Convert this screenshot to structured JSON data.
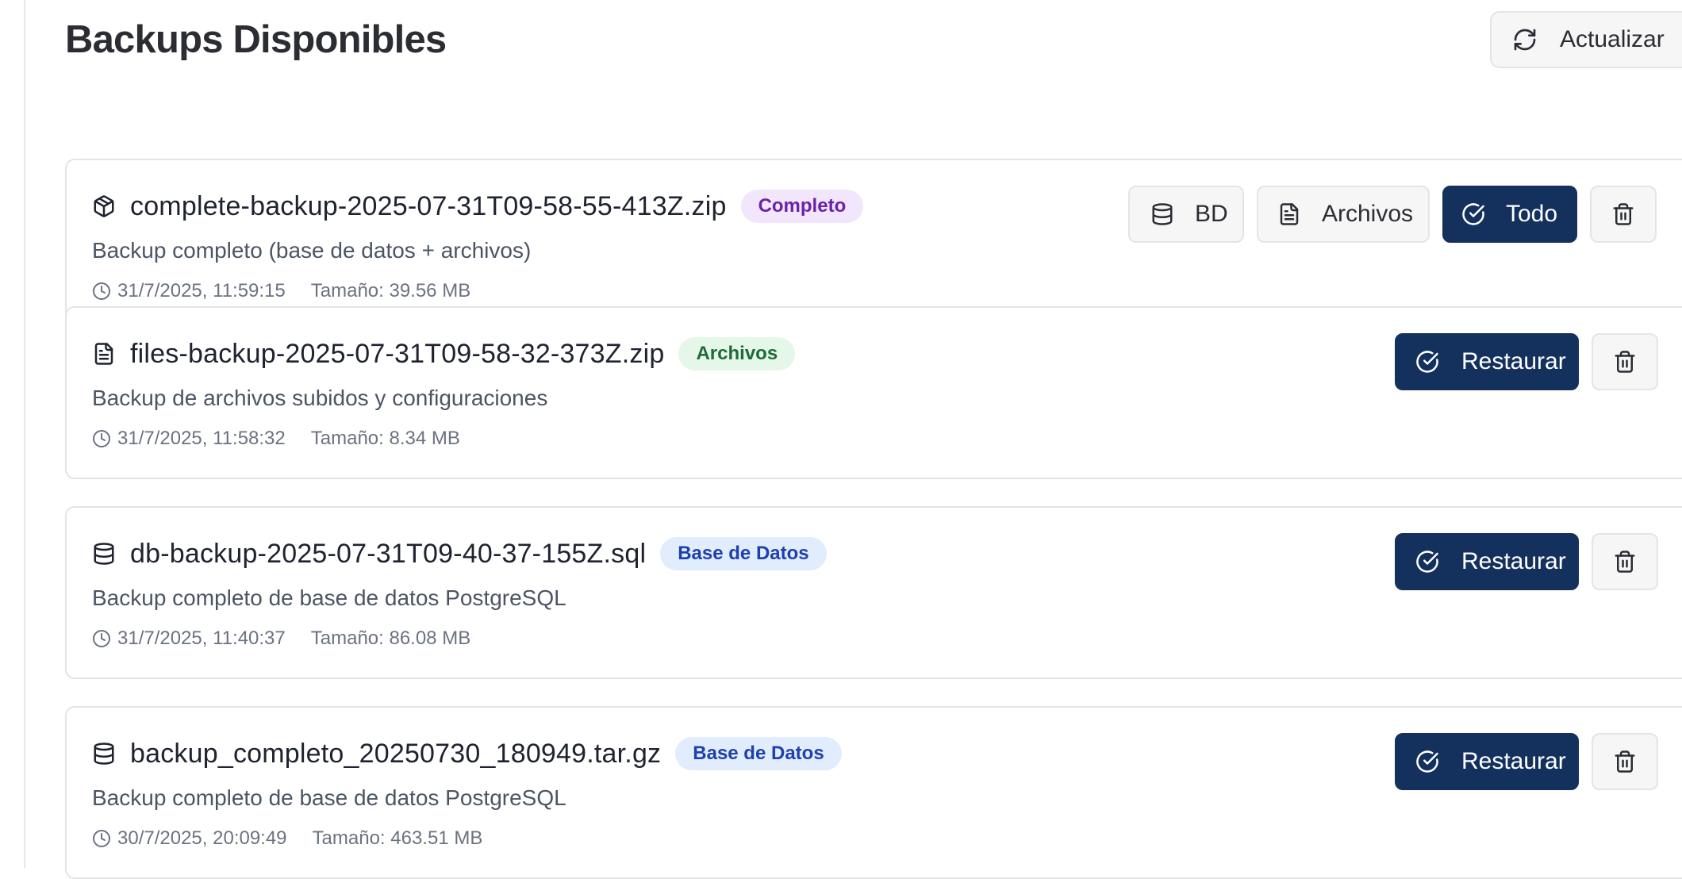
{
  "header": {
    "title": "Backups Disponibles",
    "refresh_label": "Actualizar"
  },
  "backups": [
    {
      "filename": "complete-backup-2025-07-31T09-58-55-413Z.zip",
      "badge": "Completo",
      "badge_kind": "complete",
      "type_icon": "package-icon",
      "description": "Backup completo (base de datos + archivos)",
      "date": "31/7/2025, 11:59:15",
      "size": "Tamaño: 39.56 MB",
      "actions": {
        "db_label": "BD",
        "files_label": "Archivos",
        "all_label": "Todo"
      }
    },
    {
      "filename": "files-backup-2025-07-31T09-58-32-373Z.zip",
      "badge": "Archivos",
      "badge_kind": "files",
      "type_icon": "file-text-icon",
      "description": "Backup de archivos subidos y configuraciones",
      "date": "31/7/2025, 11:58:32",
      "size": "Tamaño: 8.34 MB",
      "actions": {
        "restore_label": "Restaurar"
      }
    },
    {
      "filename": "db-backup-2025-07-31T09-40-37-155Z.sql",
      "badge": "Base de Datos",
      "badge_kind": "db",
      "type_icon": "database-icon",
      "description": "Backup completo de base de datos PostgreSQL",
      "date": "31/7/2025, 11:40:37",
      "size": "Tamaño: 86.08 MB",
      "actions": {
        "restore_label": "Restaurar"
      }
    },
    {
      "filename": "backup_completo_20250730_180949.tar.gz",
      "badge": "Base de Datos",
      "badge_kind": "db",
      "type_icon": "database-icon",
      "description": "Backup completo de base de datos PostgreSQL",
      "date": "30/7/2025, 20:09:49",
      "size": "Tamaño: 463.51 MB",
      "actions": {
        "restore_label": "Restaurar"
      }
    }
  ],
  "colors": {
    "primary": "#14315e",
    "badge_complete_bg": "#f1e6fb",
    "badge_complete_fg": "#6b21a8",
    "badge_files_bg": "#e4f7e9",
    "badge_files_fg": "#1f6b37",
    "badge_db_bg": "#e1ecfd",
    "badge_db_fg": "#1e40af"
  }
}
